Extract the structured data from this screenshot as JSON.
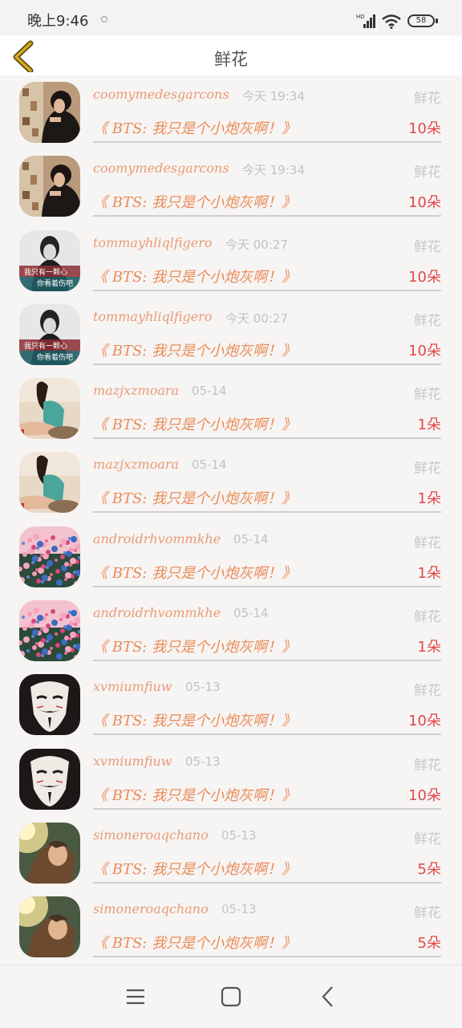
{
  "status": {
    "time": "晚上9:46",
    "network": "HD",
    "battery": "58"
  },
  "header": {
    "title": "鲜花",
    "back_icon": "chevron-left-icon"
  },
  "items": [
    {
      "user": "coomymedesgarcons",
      "time": "今天 19:34",
      "type": "鲜花",
      "message": "《 BTS: 我只是个小炮灰啊！》",
      "count": "10朵",
      "avatar": "portrait-dark"
    },
    {
      "user": "coomymedesgarcons",
      "time": "今天 19:34",
      "type": "鲜花",
      "message": "《 BTS: 我只是个小炮灰啊！》",
      "count": "10朵",
      "avatar": "portrait-dark"
    },
    {
      "user": "tommayhliqlfigero",
      "time": "今天 00:27",
      "type": "鲜花",
      "message": "《 BTS: 我只是个小炮灰啊！》",
      "count": "10朵",
      "avatar": "bw-caption",
      "avatar_caption_1": "我只有一颗心",
      "avatar_caption_2": "你看着伤吧"
    },
    {
      "user": "tommayhliqlfigero",
      "time": "今天 00:27",
      "type": "鲜花",
      "message": "《 BTS: 我只是个小炮灰啊！》",
      "count": "10朵",
      "avatar": "bw-caption",
      "avatar_caption_1": "我只有一颗心",
      "avatar_caption_2": "你看着伤吧"
    },
    {
      "user": "mazjxzmoara",
      "time": "05-14",
      "type": "鲜花",
      "message": "《 BTS: 我只是个小炮灰啊！》",
      "count": "1朵",
      "avatar": "girl-sitting"
    },
    {
      "user": "mazjxzmoara",
      "time": "05-14",
      "type": "鲜花",
      "message": "《 BTS: 我只是个小炮灰啊！》",
      "count": "1朵",
      "avatar": "girl-sitting"
    },
    {
      "user": "androidrhvommkhe",
      "time": "05-14",
      "type": "鲜花",
      "message": "《 BTS: 我只是个小炮灰啊！》",
      "count": "1朵",
      "avatar": "flower-field"
    },
    {
      "user": "androidrhvommkhe",
      "time": "05-14",
      "type": "鲜花",
      "message": "《 BTS: 我只是个小炮灰啊！》",
      "count": "1朵",
      "avatar": "flower-field"
    },
    {
      "user": "xvmiumfiuw",
      "time": "05-13",
      "type": "鲜花",
      "message": "《 BTS: 我只是个小炮灰啊！》",
      "count": "10朵",
      "avatar": "mask"
    },
    {
      "user": "xvmiumfiuw",
      "time": "05-13",
      "type": "鲜花",
      "message": "《 BTS: 我只是个小炮灰啊！》",
      "count": "10朵",
      "avatar": "mask"
    },
    {
      "user": "simoneroaqchano",
      "time": "05-13",
      "type": "鲜花",
      "message": "《 BTS: 我只是个小炮灰啊！》",
      "count": "5朵",
      "avatar": "girl-sunlight"
    },
    {
      "user": "simoneroaqchano",
      "time": "05-13",
      "type": "鲜花",
      "message": "《 BTS: 我只是个小炮灰啊！》",
      "count": "5朵",
      "avatar": "girl-sunlight"
    }
  ],
  "nav": {
    "menu_icon": "menu-icon",
    "home_icon": "home-square-icon",
    "back_icon": "back-chevron-icon"
  },
  "colors": {
    "username": "#e89b73",
    "message": "#ea8b55",
    "count": "#e04848",
    "muted": "#c2c2c2",
    "back_arrow": "#c9a21c"
  }
}
